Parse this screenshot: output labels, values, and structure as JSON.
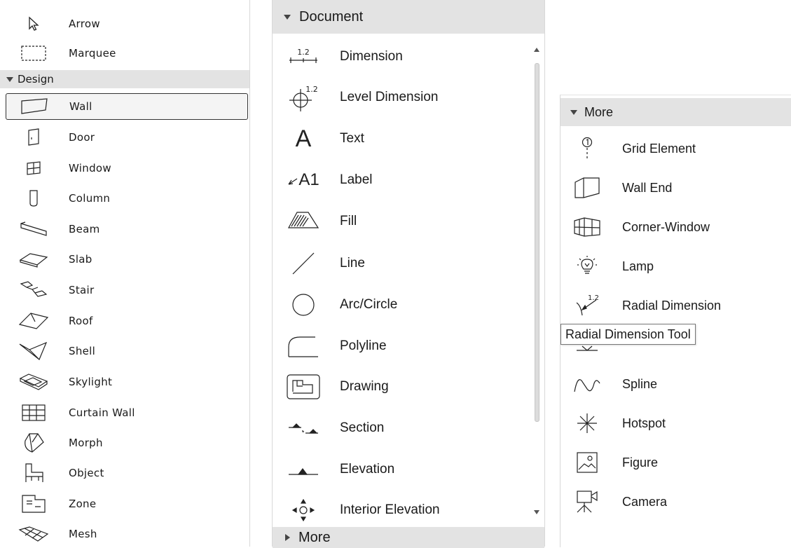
{
  "panel_left": {
    "top_items": [
      {
        "label": "Arrow",
        "icon": "arrow-pointer-icon"
      },
      {
        "label": "Marquee",
        "icon": "marquee-icon"
      }
    ],
    "design_header": "Design",
    "design_items": [
      {
        "label": "Wall",
        "icon": "wall-icon",
        "selected": true
      },
      {
        "label": "Door",
        "icon": "door-icon"
      },
      {
        "label": "Window",
        "icon": "window-icon"
      },
      {
        "label": "Column",
        "icon": "column-icon"
      },
      {
        "label": "Beam",
        "icon": "beam-icon"
      },
      {
        "label": "Slab",
        "icon": "slab-icon"
      },
      {
        "label": "Stair",
        "icon": "stair-icon"
      },
      {
        "label": "Roof",
        "icon": "roof-icon"
      },
      {
        "label": "Shell",
        "icon": "shell-icon"
      },
      {
        "label": "Skylight",
        "icon": "skylight-icon"
      },
      {
        "label": "Curtain Wall",
        "icon": "curtain-wall-icon"
      },
      {
        "label": "Morph",
        "icon": "morph-icon"
      },
      {
        "label": "Object",
        "icon": "object-chair-icon"
      },
      {
        "label": "Zone",
        "icon": "zone-icon"
      },
      {
        "label": "Mesh",
        "icon": "mesh-icon"
      }
    ]
  },
  "panel_document": {
    "header": "Document",
    "items": [
      {
        "label": "Dimension",
        "icon": "dimension-icon"
      },
      {
        "label": "Level Dimension",
        "icon": "level-dimension-icon"
      },
      {
        "label": "Text",
        "icon": "text-icon"
      },
      {
        "label": "Label",
        "icon": "label-icon"
      },
      {
        "label": "Fill",
        "icon": "fill-icon"
      },
      {
        "label": "Line",
        "icon": "line-icon"
      },
      {
        "label": "Arc/Circle",
        "icon": "arc-circle-icon"
      },
      {
        "label": "Polyline",
        "icon": "polyline-icon"
      },
      {
        "label": "Drawing",
        "icon": "drawing-icon"
      },
      {
        "label": "Section",
        "icon": "section-icon"
      },
      {
        "label": "Elevation",
        "icon": "elevation-icon"
      },
      {
        "label": "Interior Elevation",
        "icon": "interior-elevation-icon"
      }
    ],
    "footer": "More",
    "dimension_glyph": "1.2",
    "text_glyph": "A",
    "label_glyph": "A1"
  },
  "panel_more": {
    "header": "More",
    "items": [
      {
        "label": "Grid Element",
        "icon": "grid-element-icon"
      },
      {
        "label": "Wall End",
        "icon": "wall-end-icon"
      },
      {
        "label": "Corner-Window",
        "icon": "corner-window-icon"
      },
      {
        "label": "Lamp",
        "icon": "lamp-icon"
      },
      {
        "label": "Radial Dimension",
        "icon": "radial-dimension-icon"
      },
      {
        "label": "",
        "icon": "change-marker-icon",
        "hidden_by_tooltip": true
      },
      {
        "label": "Spline",
        "icon": "spline-icon"
      },
      {
        "label": "Hotspot",
        "icon": "hotspot-icon"
      },
      {
        "label": "Figure",
        "icon": "figure-icon"
      },
      {
        "label": "Camera",
        "icon": "camera-icon"
      }
    ],
    "tooltip": "Radial Dimension Tool"
  }
}
